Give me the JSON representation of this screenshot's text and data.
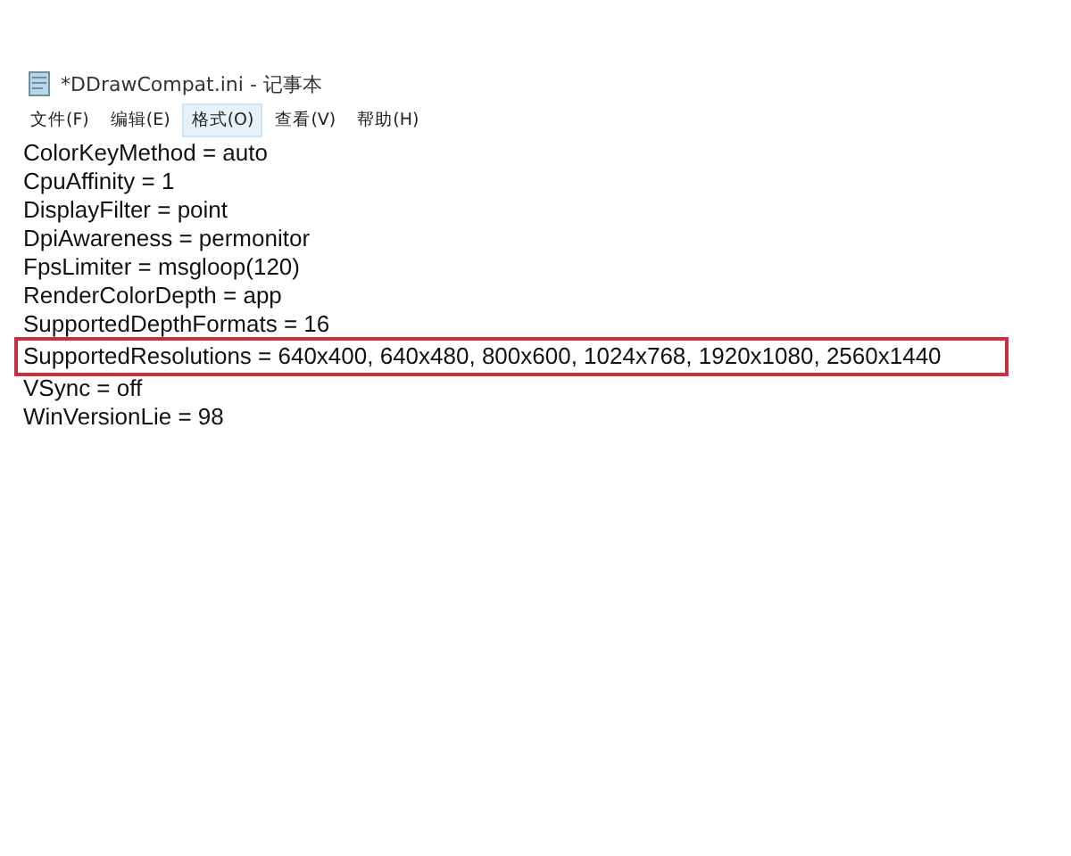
{
  "window": {
    "title": "*DDrawCompat.ini - 记事本"
  },
  "menu": [
    {
      "label": "文件(F)",
      "selected": false
    },
    {
      "label": "编辑(E)",
      "selected": false
    },
    {
      "label": "格式(O)",
      "selected": true
    },
    {
      "label": "查看(V)",
      "selected": false
    },
    {
      "label": "帮助(H)",
      "selected": false
    }
  ],
  "lines": [
    {
      "text": "ColorKeyMethod = auto",
      "highlighted": false
    },
    {
      "text": "CpuAffinity = 1",
      "highlighted": false
    },
    {
      "text": "DisplayFilter = point",
      "highlighted": false
    },
    {
      "text": "DpiAwareness = permonitor",
      "highlighted": false
    },
    {
      "text": "FpsLimiter = msgloop(120)",
      "highlighted": false
    },
    {
      "text": "RenderColorDepth = app",
      "highlighted": false
    },
    {
      "text": "SupportedDepthFormats = 16",
      "highlighted": false
    },
    {
      "text": "SupportedResolutions = 640x400, 640x480, 800x600, 1024x768, 1920x1080, 2560x1440",
      "highlighted": true
    },
    {
      "text": "VSync = off",
      "highlighted": false
    },
    {
      "text": "WinVersionLie = 98",
      "highlighted": false
    }
  ]
}
